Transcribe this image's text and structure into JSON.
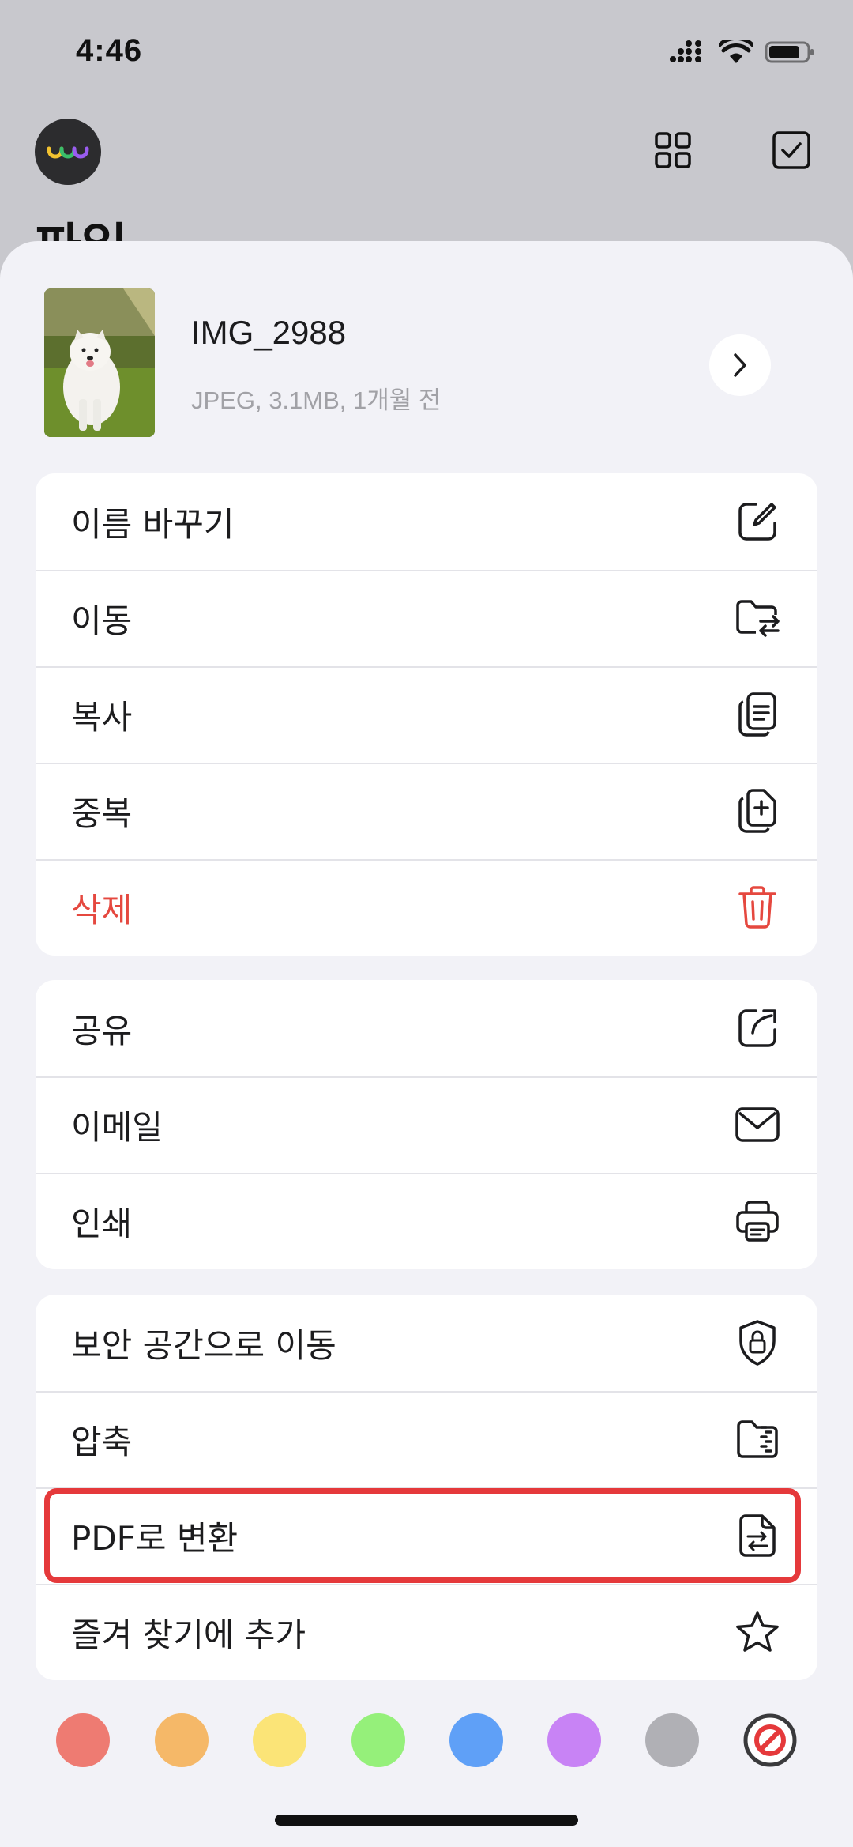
{
  "status_bar": {
    "time": "4:46"
  },
  "background": {
    "title": "파일"
  },
  "file": {
    "name": "IMG_2988",
    "meta": "JPEG, 3.1MB, 1개월 전"
  },
  "menu_group_1": [
    {
      "label": "이름 바꾸기",
      "icon": "rename-icon"
    },
    {
      "label": "이동",
      "icon": "move-folder-icon"
    },
    {
      "label": "복사",
      "icon": "copy-icon"
    },
    {
      "label": "중복",
      "icon": "duplicate-icon"
    },
    {
      "label": "삭제",
      "icon": "trash-icon"
    }
  ],
  "menu_group_2": [
    {
      "label": "공유",
      "icon": "share-icon"
    },
    {
      "label": "이메일",
      "icon": "mail-icon"
    },
    {
      "label": "인쇄",
      "icon": "printer-icon"
    }
  ],
  "menu_group_3": [
    {
      "label": "보안 공간으로 이동",
      "icon": "shield-lock-icon"
    },
    {
      "label": "압축",
      "icon": "zip-folder-icon"
    },
    {
      "label": "PDF로 변환",
      "icon": "convert-pdf-icon"
    },
    {
      "label": "즐겨 찾기에 추가",
      "icon": "star-icon"
    }
  ],
  "tag_colors": [
    {
      "name": "red",
      "color": "#ee7b72"
    },
    {
      "name": "orange",
      "color": "#f5b868"
    },
    {
      "name": "yellow",
      "color": "#fbe477"
    },
    {
      "name": "green",
      "color": "#95f07a"
    },
    {
      "name": "blue",
      "color": "#5fa0f7"
    },
    {
      "name": "purple",
      "color": "#c883f5"
    },
    {
      "name": "gray",
      "color": "#b0b0b5"
    },
    {
      "name": "none",
      "color": "#e5393b"
    }
  ],
  "colors": {
    "danger": "#e5483f",
    "highlight": "#e5393b"
  }
}
